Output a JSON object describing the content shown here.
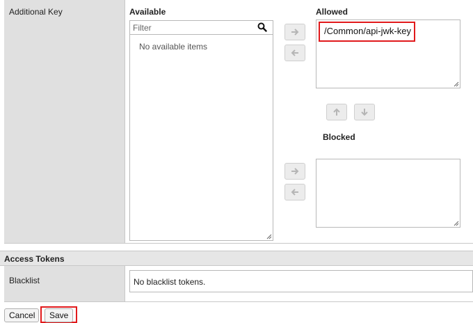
{
  "additional_key": {
    "label": "Additional Key",
    "available_heading": "Available",
    "filter_placeholder": "Filter",
    "available_empty": "No available items",
    "allowed_heading": "Allowed",
    "allowed_items": [
      "/Common/api-jwk-key"
    ],
    "blocked_heading": "Blocked"
  },
  "access_tokens": {
    "section_title": "Access Tokens",
    "blacklist_label": "Blacklist",
    "blacklist_value": "No blacklist tokens."
  },
  "footer": {
    "cancel_label": "Cancel",
    "save_label": "Save"
  },
  "icons": {
    "search": "search-icon",
    "move_right": "arrow-right-icon",
    "move_left": "arrow-left-icon",
    "move_up": "arrow-up-icon",
    "move_down": "arrow-down-icon"
  },
  "colors": {
    "highlight": "#e1191b",
    "label_bg": "#e0e0e0",
    "button_bg": "#ececec"
  }
}
